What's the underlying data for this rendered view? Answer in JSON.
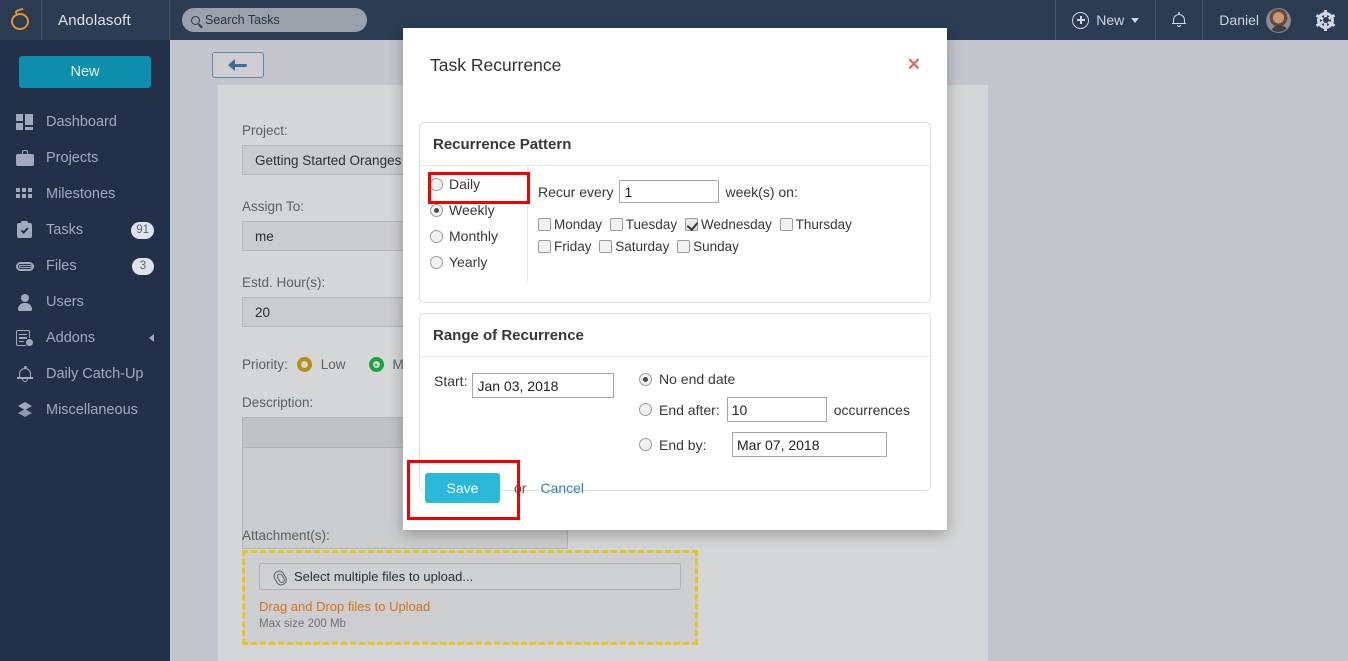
{
  "topbar": {
    "logo_icon": "orange-fruit-logo-icon",
    "brand": "Andolasoft",
    "search": {
      "icon": "search-icon",
      "placeholder": "Search Tasks",
      "value": ""
    },
    "new_button": {
      "icon": "plus-circle-icon",
      "label": "New",
      "caret": "chevron-down-icon"
    },
    "notifications_icon": "bell-icon",
    "user_name": "Daniel",
    "avatar": "user-avatar",
    "settings_icon": "gear-icon"
  },
  "sidebar": {
    "new_button": "New",
    "items": [
      {
        "label": "Dashboard",
        "icon": "dashboard-icon",
        "badge": ""
      },
      {
        "label": "Projects",
        "icon": "briefcase-icon",
        "badge": ""
      },
      {
        "label": "Milestones",
        "icon": "grid-icon",
        "badge": ""
      },
      {
        "label": "Tasks",
        "icon": "clipboard-check-icon",
        "badge": "91"
      },
      {
        "label": "Files",
        "icon": "paperclip-icon",
        "badge": "3"
      },
      {
        "label": "Users",
        "icon": "user-icon",
        "badge": ""
      },
      {
        "label": "Addons",
        "icon": "addons-icon",
        "badge": "",
        "chevron": "chevron-left-icon"
      },
      {
        "label": "Daily Catch-Up",
        "icon": "bell-alert-icon",
        "badge": ""
      },
      {
        "label": "Miscellaneous",
        "icon": "layers-icon",
        "badge": ""
      }
    ]
  },
  "form": {
    "back_icon": "back-arrow-icon",
    "project_label": "Project:",
    "project_value": "Getting Started Oranges",
    "assign_label": "Assign To:",
    "assign_value": "me",
    "hours_label": "Estd. Hour(s):",
    "hours_value": "20",
    "priority_label": "Priority:",
    "priority_low": "Low",
    "priority_medium": "M",
    "description_label": "Description:",
    "description_value": "",
    "attachment_label": "Attachment(s):",
    "upload_icon": "paperclip-icon",
    "upload_button": "Select multiple files to upload...",
    "drag_text": "Drag and Drop files to Upload",
    "max_size": "Max size 200 Mb"
  },
  "modal": {
    "title": "Task Recurrence",
    "close_icon": "close-icon",
    "pattern": {
      "legend": "Recurrence Pattern",
      "options": [
        {
          "label": "Daily",
          "selected": false
        },
        {
          "label": "Weekly",
          "selected": true
        },
        {
          "label": "Monthly",
          "selected": false
        },
        {
          "label": "Yearly",
          "selected": false
        }
      ],
      "recur_prefix": "Recur every",
      "recur_value": "1",
      "recur_suffix": "week(s) on:",
      "days_row1": [
        {
          "label": "Monday",
          "checked": false
        },
        {
          "label": "Tuesday",
          "checked": false
        },
        {
          "label": "Wednesday",
          "checked": true
        },
        {
          "label": "Thursday",
          "checked": false
        }
      ],
      "days_row2": [
        {
          "label": "Friday",
          "checked": false
        },
        {
          "label": "Saturday",
          "checked": false
        },
        {
          "label": "Sunday",
          "checked": false
        }
      ]
    },
    "range": {
      "legend": "Range of Recurrence",
      "start_label": "Start:",
      "start_value": "Jan 03, 2018",
      "no_end_label": "No end date",
      "no_end_selected": true,
      "end_after_label": "End after:",
      "end_after_selected": false,
      "end_after_value": "10",
      "occurrences_label": "occurrences",
      "end_by_label": "End by:",
      "end_by_selected": false,
      "end_by_value": "Mar 07, 2018"
    },
    "save_label": "Save",
    "or_label": "or",
    "cancel_label": "Cancel"
  },
  "colors": {
    "topbar": "#2b3c53",
    "sidebar": "#22304a",
    "accent_teal": "#0d8fad",
    "save_blue": "#29b8d8",
    "highlight_red": "#f40000",
    "dropzone_yellow": "#e3c818",
    "drag_orange": "#d2741d",
    "logo_orange": "#e7922b"
  }
}
